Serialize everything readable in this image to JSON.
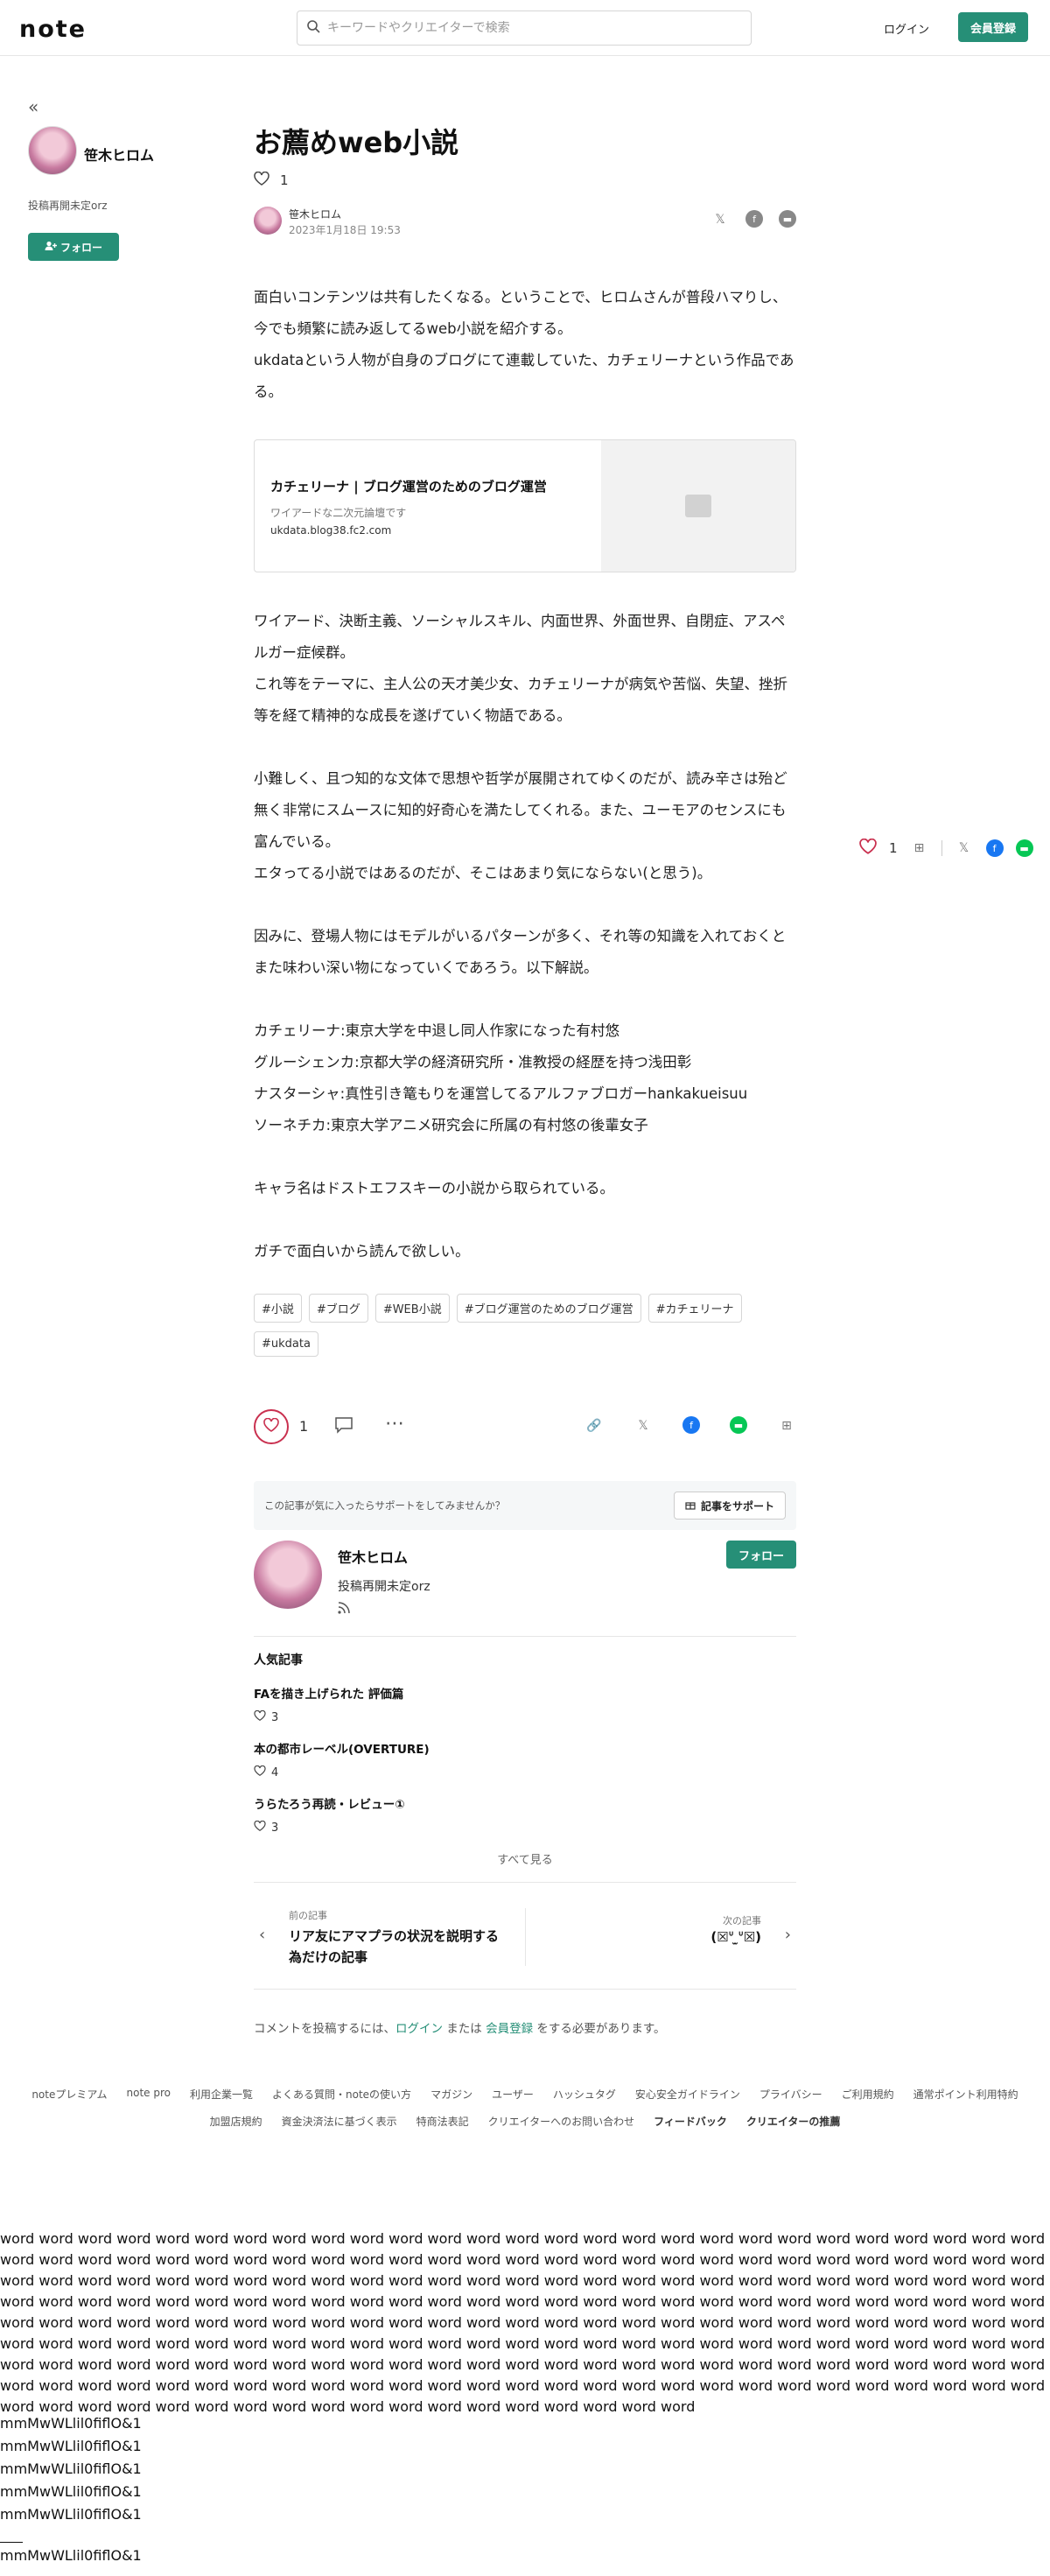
{
  "header": {
    "logo": "note",
    "search_placeholder": "キーワードやクリエイターで検索",
    "login": "ログイン",
    "signup": "会員登録"
  },
  "sidebar": {
    "name": "笹木ヒロム",
    "bio": "投稿再開未定orz",
    "follow": "フォロー"
  },
  "article": {
    "title": "お薦めweb小説",
    "like_count": "1",
    "author": "笹木ヒロム",
    "date": "2023年1月18日 19:53",
    "intro": [
      "面白いコンテンツは共有したくなる。ということで、ヒロムさんが普段ハマりし、今でも頻繁に読み返してるweb小説を紹介する。",
      "ukdataという人物が自身のブログにて連載していた、カチェリーナという作品である。"
    ],
    "card": {
      "title": "カチェリーナ | ブログ運営のためのブログ運営",
      "desc": "ワイアードな二次元論壇です",
      "url": "ukdata.blog38.fc2.com"
    },
    "paragraphs": [
      "ワイアード、決断主義、ソーシャルスキル、内面世界、外面世界、自閉症、アスペルガー症候群。",
      "これ等をテーマに、主人公の天才美少女、カチェリーナが病気や苦悩、失望、挫折等を経て精神的な成長を遂げていく物語である。",
      "",
      "小難しく、且つ知的な文体で思想や哲学が展開されてゆくのだが、読み辛さは殆ど無く非常にスムースに知的好奇心を満たしてくれる。また、ユーモアのセンスにも富んでいる。",
      "エタってる小説ではあるのだが、そこはあまり気にならない(と思う)。",
      "",
      "因みに、登場人物にはモデルがいるパターンが多く、それ等の知識を入れておくとまた味わい深い物になっていくであろう。以下解説。",
      "",
      "カチェリーナ:東京大学を中退し同人作家になった有村悠",
      "グルーシェンカ:京都大学の経済研究所・准教授の経歴を持つ浅田彰",
      "ナスターシャ:真性引き篭もりを運営してるアルファブロガーhankakueisuu",
      "ソーネチカ:東京大学アニメ研究会に所属の有村悠の後輩女子",
      "",
      "キャラ名はドストエフスキーの小説から取られている。",
      "",
      "ガチで面白いから読んで欲しい。"
    ],
    "tags": [
      "#小説",
      "#ブログ",
      "#WEB小説",
      "#ブログ運営のためのブログ運営",
      "#カチェリーナ",
      "#ukdata"
    ]
  },
  "support": {
    "text": "この記事が気に入ったらサポートをしてみませんか？",
    "button": "記事をサポート"
  },
  "profile": {
    "name": "笹木ヒロム",
    "bio": "投稿再開未定orz",
    "follow": "フォロー"
  },
  "popular": {
    "heading": "人気記事",
    "items": [
      {
        "title": "FAを描き上げられた 評価篇",
        "likes": "3"
      },
      {
        "title": "本の都市レーベル(OVERTURE)",
        "likes": "4"
      },
      {
        "title": "うらたろう再読・レビュー①",
        "likes": "3"
      }
    ],
    "see_all": "すべて見る"
  },
  "nav": {
    "prev_label": "前の記事",
    "prev_title": "リア友にアマプラの状況を説明する為だけの記事",
    "next_label": "次の記事",
    "next_title": "(☒ᐡ ̫ᐡ☒)"
  },
  "comment": {
    "prefix": "コメントを投稿するには、",
    "login": "ログイン",
    "mid": " または ",
    "signup": "会員登録",
    "suffix": " をする必要があります。"
  },
  "float": {
    "like_count": "1"
  },
  "footer": {
    "row1": [
      "noteプレミアム",
      "note pro",
      "利用企業一覧",
      "よくある質問・noteの使い方",
      "マガジン",
      "ユーザー",
      "ハッシュタグ",
      "安心安全ガイドライン",
      "プライバシー",
      "ご利用規約",
      "通常ポイント利用特約"
    ],
    "row2": [
      "加盟店規約",
      "資金決済法に基づく表示",
      "特商法表記",
      "クリエイターへのお問い合わせ"
    ],
    "row2_bold": [
      "フィードバック",
      "クリエイターの推薦"
    ]
  },
  "filler": {
    "words": "word word word word word word word word word word word word word word word word word word word word word word word word word word word word word word word word word word word word word word word word word word word word word word word word word word word word word word word word word word word word word word word word word word word word word word word word word word word word word word word word word word word word word word word word word word word word word word word word word word word word word word word word word word word word word word word word word word word word word word word word word word word word word word word word word word word word word word word word word word word word word word word word word word word word word word word word word word word word word word word word word word word word word word word word word word word word word word word word word word word word word word word word word word word word word word word word word word word word word word word word word word word word word word word word word word word word word word word word word word word word word word word word word word word word word word word word word word",
    "lines": [
      "mmMwWLlil0fiflO&1",
      "mmMwWLlil0fiflO&1",
      "mmMwWLlil0fiflO&1",
      "mmMwWLlil0fiflO&1",
      "mmMwWLlil0fiflO&1"
    ],
    "last": "mmMwWLlil0fiflO&1"
  }
}
